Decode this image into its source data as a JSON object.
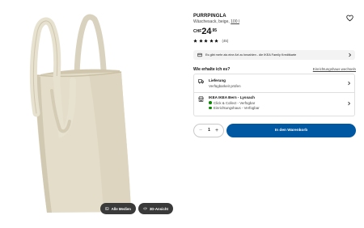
{
  "gallery": {
    "pills": [
      {
        "label": "Alle Medien",
        "icon": "image-icon"
      },
      {
        "label": "3D-Ansicht",
        "icon": "rotate-3d-icon"
      }
    ]
  },
  "product": {
    "name": "PURRPINGLA",
    "description": "Wäschesack, beige,",
    "size": "100 l",
    "price": {
      "currency": "CHF",
      "main": "24",
      "decimal": ".95"
    },
    "rating": {
      "stars": 5,
      "max": 5,
      "count": "(45)"
    }
  },
  "banner": {
    "text": "Es gibt mehr als eine Art zu bezahlen - die IKEA Family Kreditkarte",
    "icon": "credit-card-icon"
  },
  "availability": {
    "question": "Wie erhalte ich es?",
    "store_link": "Einrichtungshaus wechseln",
    "delivery": {
      "title": "Lieferung",
      "status": "Verfügbarkeit prüfen",
      "icon": "truck-icon"
    },
    "store": {
      "title": "IKEA IKEA Bern - Lyssach",
      "line1": "Click & Collect - Verfügbar",
      "line2": "Einrichtungshaus - Verfügbar",
      "icon": "store-icon",
      "status_color": "#0a8a00"
    }
  },
  "purchase": {
    "minus": "−",
    "quantity": "1",
    "plus": "+",
    "cart_label": "In den Warenkorb",
    "accent": "#0058a3"
  }
}
